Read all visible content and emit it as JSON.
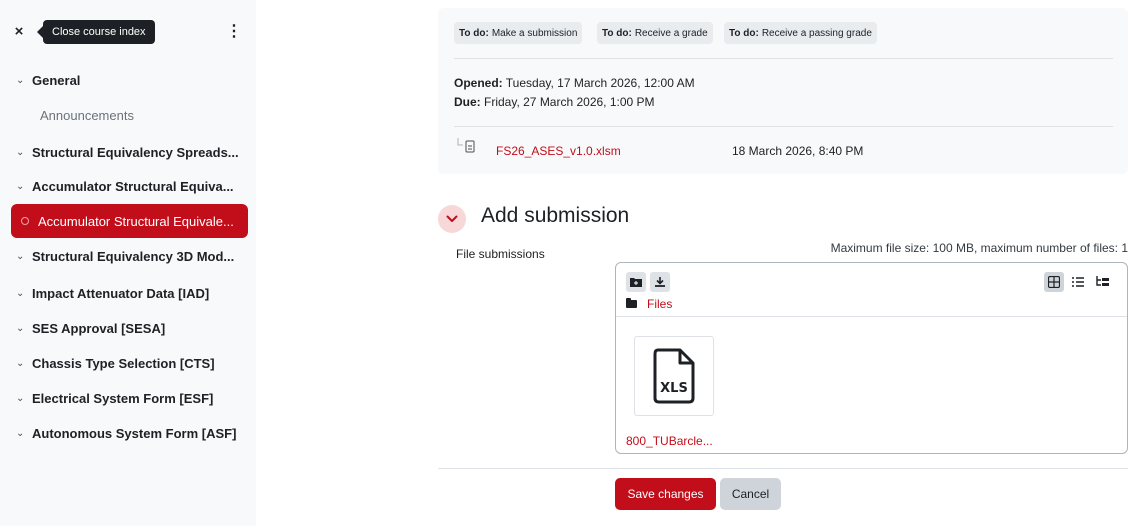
{
  "sidebar": {
    "close_icon": "×",
    "tooltip": "Close course index",
    "menu_icon": "⋮",
    "items": [
      {
        "label": "General",
        "type": "section"
      },
      {
        "label": "Announcements",
        "type": "sub"
      },
      {
        "label": "Structural Equivalency Spreads...",
        "type": "section"
      },
      {
        "label": "Accumulator Structural Equiva...",
        "type": "section"
      },
      {
        "label": "Accumulator Structural Equivale...",
        "type": "active"
      },
      {
        "label": "Structural Equivalency 3D Mod...",
        "type": "section"
      },
      {
        "label": "Impact Attenuator Data [IAD]",
        "type": "section"
      },
      {
        "label": "SES Approval [SESA]",
        "type": "section"
      },
      {
        "label": "Chassis Type Selection [CTS]",
        "type": "section"
      },
      {
        "label": "Electrical System Form [ESF]",
        "type": "section"
      },
      {
        "label": "Autonomous System Form [ASF]",
        "type": "section"
      }
    ]
  },
  "todos": [
    {
      "prefix": "To do:",
      "text": "Make a submission"
    },
    {
      "prefix": "To do:",
      "text": "Receive a grade"
    },
    {
      "prefix": "To do:",
      "text": "Receive a passing grade"
    }
  ],
  "dates": {
    "opened_label": "Opened:",
    "opened_value": "Tuesday, 17 March 2026, 12:00 AM",
    "due_label": "Due:",
    "due_value": "Friday, 27 March 2026, 1:00 PM"
  },
  "attachment": {
    "file_name": "FS26_ASES_v1.0.xlsm",
    "date": "18 March 2026, 8:40 PM"
  },
  "submission": {
    "title": "Add submission",
    "field_label": "File submissions",
    "limits": "Maximum file size: 100 MB, maximum number of files: 1",
    "path_label": "Files",
    "file_tile_text": "XLS",
    "file_name": "800_TUBarcle..."
  },
  "buttons": {
    "save": "Save changes",
    "cancel": "Cancel"
  },
  "colors": {
    "accent": "#c20e1a",
    "sidebar_bg": "#f8f9fa"
  }
}
